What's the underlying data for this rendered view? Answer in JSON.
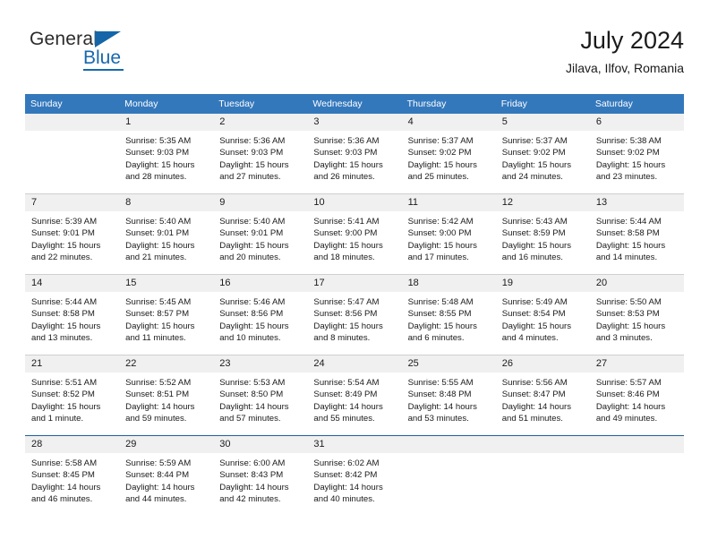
{
  "brand": {
    "name_part1": "General",
    "name_part2": "Blue",
    "accent_color": "#1668ad",
    "triangle_icon": "triangle-icon"
  },
  "header": {
    "title": "July 2024",
    "subtitle": "Jilava, Ilfov, Romania"
  },
  "calendar": {
    "header_bg": "#3478bc",
    "daynum_bg": "#f0f0f0",
    "columns": [
      "Sunday",
      "Monday",
      "Tuesday",
      "Wednesday",
      "Thursday",
      "Friday",
      "Saturday"
    ],
    "weeks": [
      [
        {
          "day": "",
          "sunrise": "",
          "sunset": "",
          "daylight_line1": "",
          "daylight_line2": ""
        },
        {
          "day": "1",
          "sunrise": "Sunrise: 5:35 AM",
          "sunset": "Sunset: 9:03 PM",
          "daylight_line1": "Daylight: 15 hours",
          "daylight_line2": "and 28 minutes."
        },
        {
          "day": "2",
          "sunrise": "Sunrise: 5:36 AM",
          "sunset": "Sunset: 9:03 PM",
          "daylight_line1": "Daylight: 15 hours",
          "daylight_line2": "and 27 minutes."
        },
        {
          "day": "3",
          "sunrise": "Sunrise: 5:36 AM",
          "sunset": "Sunset: 9:03 PM",
          "daylight_line1": "Daylight: 15 hours",
          "daylight_line2": "and 26 minutes."
        },
        {
          "day": "4",
          "sunrise": "Sunrise: 5:37 AM",
          "sunset": "Sunset: 9:02 PM",
          "daylight_line1": "Daylight: 15 hours",
          "daylight_line2": "and 25 minutes."
        },
        {
          "day": "5",
          "sunrise": "Sunrise: 5:37 AM",
          "sunset": "Sunset: 9:02 PM",
          "daylight_line1": "Daylight: 15 hours",
          "daylight_line2": "and 24 minutes."
        },
        {
          "day": "6",
          "sunrise": "Sunrise: 5:38 AM",
          "sunset": "Sunset: 9:02 PM",
          "daylight_line1": "Daylight: 15 hours",
          "daylight_line2": "and 23 minutes."
        }
      ],
      [
        {
          "day": "7",
          "sunrise": "Sunrise: 5:39 AM",
          "sunset": "Sunset: 9:01 PM",
          "daylight_line1": "Daylight: 15 hours",
          "daylight_line2": "and 22 minutes."
        },
        {
          "day": "8",
          "sunrise": "Sunrise: 5:40 AM",
          "sunset": "Sunset: 9:01 PM",
          "daylight_line1": "Daylight: 15 hours",
          "daylight_line2": "and 21 minutes."
        },
        {
          "day": "9",
          "sunrise": "Sunrise: 5:40 AM",
          "sunset": "Sunset: 9:01 PM",
          "daylight_line1": "Daylight: 15 hours",
          "daylight_line2": "and 20 minutes."
        },
        {
          "day": "10",
          "sunrise": "Sunrise: 5:41 AM",
          "sunset": "Sunset: 9:00 PM",
          "daylight_line1": "Daylight: 15 hours",
          "daylight_line2": "and 18 minutes."
        },
        {
          "day": "11",
          "sunrise": "Sunrise: 5:42 AM",
          "sunset": "Sunset: 9:00 PM",
          "daylight_line1": "Daylight: 15 hours",
          "daylight_line2": "and 17 minutes."
        },
        {
          "day": "12",
          "sunrise": "Sunrise: 5:43 AM",
          "sunset": "Sunset: 8:59 PM",
          "daylight_line1": "Daylight: 15 hours",
          "daylight_line2": "and 16 minutes."
        },
        {
          "day": "13",
          "sunrise": "Sunrise: 5:44 AM",
          "sunset": "Sunset: 8:58 PM",
          "daylight_line1": "Daylight: 15 hours",
          "daylight_line2": "and 14 minutes."
        }
      ],
      [
        {
          "day": "14",
          "sunrise": "Sunrise: 5:44 AM",
          "sunset": "Sunset: 8:58 PM",
          "daylight_line1": "Daylight: 15 hours",
          "daylight_line2": "and 13 minutes."
        },
        {
          "day": "15",
          "sunrise": "Sunrise: 5:45 AM",
          "sunset": "Sunset: 8:57 PM",
          "daylight_line1": "Daylight: 15 hours",
          "daylight_line2": "and 11 minutes."
        },
        {
          "day": "16",
          "sunrise": "Sunrise: 5:46 AM",
          "sunset": "Sunset: 8:56 PM",
          "daylight_line1": "Daylight: 15 hours",
          "daylight_line2": "and 10 minutes."
        },
        {
          "day": "17",
          "sunrise": "Sunrise: 5:47 AM",
          "sunset": "Sunset: 8:56 PM",
          "daylight_line1": "Daylight: 15 hours",
          "daylight_line2": "and 8 minutes."
        },
        {
          "day": "18",
          "sunrise": "Sunrise: 5:48 AM",
          "sunset": "Sunset: 8:55 PM",
          "daylight_line1": "Daylight: 15 hours",
          "daylight_line2": "and 6 minutes."
        },
        {
          "day": "19",
          "sunrise": "Sunrise: 5:49 AM",
          "sunset": "Sunset: 8:54 PM",
          "daylight_line1": "Daylight: 15 hours",
          "daylight_line2": "and 4 minutes."
        },
        {
          "day": "20",
          "sunrise": "Sunrise: 5:50 AM",
          "sunset": "Sunset: 8:53 PM",
          "daylight_line1": "Daylight: 15 hours",
          "daylight_line2": "and 3 minutes."
        }
      ],
      [
        {
          "day": "21",
          "sunrise": "Sunrise: 5:51 AM",
          "sunset": "Sunset: 8:52 PM",
          "daylight_line1": "Daylight: 15 hours",
          "daylight_line2": "and 1 minute."
        },
        {
          "day": "22",
          "sunrise": "Sunrise: 5:52 AM",
          "sunset": "Sunset: 8:51 PM",
          "daylight_line1": "Daylight: 14 hours",
          "daylight_line2": "and 59 minutes."
        },
        {
          "day": "23",
          "sunrise": "Sunrise: 5:53 AM",
          "sunset": "Sunset: 8:50 PM",
          "daylight_line1": "Daylight: 14 hours",
          "daylight_line2": "and 57 minutes."
        },
        {
          "day": "24",
          "sunrise": "Sunrise: 5:54 AM",
          "sunset": "Sunset: 8:49 PM",
          "daylight_line1": "Daylight: 14 hours",
          "daylight_line2": "and 55 minutes."
        },
        {
          "day": "25",
          "sunrise": "Sunrise: 5:55 AM",
          "sunset": "Sunset: 8:48 PM",
          "daylight_line1": "Daylight: 14 hours",
          "daylight_line2": "and 53 minutes."
        },
        {
          "day": "26",
          "sunrise": "Sunrise: 5:56 AM",
          "sunset": "Sunset: 8:47 PM",
          "daylight_line1": "Daylight: 14 hours",
          "daylight_line2": "and 51 minutes."
        },
        {
          "day": "27",
          "sunrise": "Sunrise: 5:57 AM",
          "sunset": "Sunset: 8:46 PM",
          "daylight_line1": "Daylight: 14 hours",
          "daylight_line2": "and 49 minutes."
        }
      ],
      [
        {
          "day": "28",
          "sunrise": "Sunrise: 5:58 AM",
          "sunset": "Sunset: 8:45 PM",
          "daylight_line1": "Daylight: 14 hours",
          "daylight_line2": "and 46 minutes."
        },
        {
          "day": "29",
          "sunrise": "Sunrise: 5:59 AM",
          "sunset": "Sunset: 8:44 PM",
          "daylight_line1": "Daylight: 14 hours",
          "daylight_line2": "and 44 minutes."
        },
        {
          "day": "30",
          "sunrise": "Sunrise: 6:00 AM",
          "sunset": "Sunset: 8:43 PM",
          "daylight_line1": "Daylight: 14 hours",
          "daylight_line2": "and 42 minutes."
        },
        {
          "day": "31",
          "sunrise": "Sunrise: 6:02 AM",
          "sunset": "Sunset: 8:42 PM",
          "daylight_line1": "Daylight: 14 hours",
          "daylight_line2": "and 40 minutes."
        },
        {
          "day": "",
          "sunrise": "",
          "sunset": "",
          "daylight_line1": "",
          "daylight_line2": ""
        },
        {
          "day": "",
          "sunrise": "",
          "sunset": "",
          "daylight_line1": "",
          "daylight_line2": ""
        },
        {
          "day": "",
          "sunrise": "",
          "sunset": "",
          "daylight_line1": "",
          "daylight_line2": ""
        }
      ]
    ]
  }
}
